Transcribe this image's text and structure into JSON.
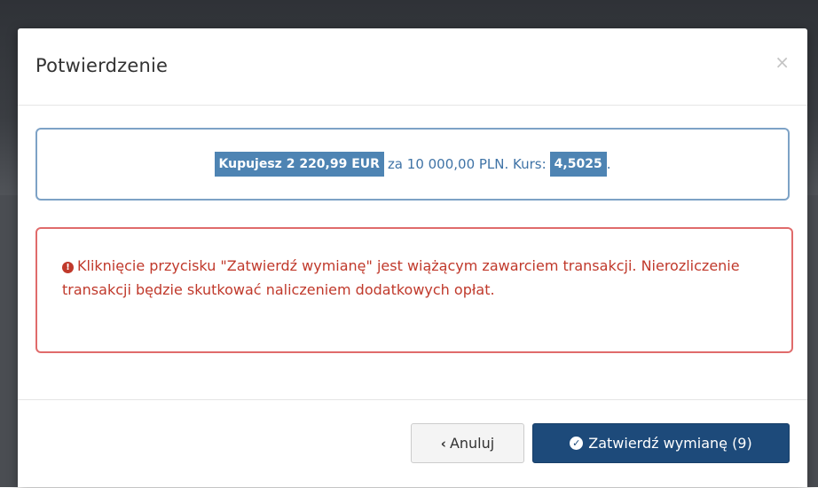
{
  "modal": {
    "title": "Potwierdzenie",
    "close_label": "×"
  },
  "summary": {
    "buy_part": "Kupujesz 2 220,99 EUR",
    "middle_part": "za 10 000,00 PLN. Kurs:",
    "rate": "4,5025",
    "end": "."
  },
  "warning": {
    "icon": "!",
    "text": "Kliknięcie przycisku \"Zatwierdź wymianę\" jest wiążącym zawarciem transakcji. Nierozliczenie transakcji będzie skutkować naliczeniem dodatkowych opłat."
  },
  "footer": {
    "cancel_label": "Anuluj",
    "confirm_label": "Zatwierdź wymianę (9)"
  },
  "colors": {
    "primary": "#1d4a7a",
    "info_border": "#7da2c6",
    "highlight": "#4e84b3",
    "danger": "#c0392b",
    "danger_border": "#e06b6b"
  },
  "icons": {
    "close": "close-icon",
    "warning": "exclamation-circle-icon",
    "cancel": "chevron-left-icon",
    "confirm": "check-circle-icon"
  }
}
